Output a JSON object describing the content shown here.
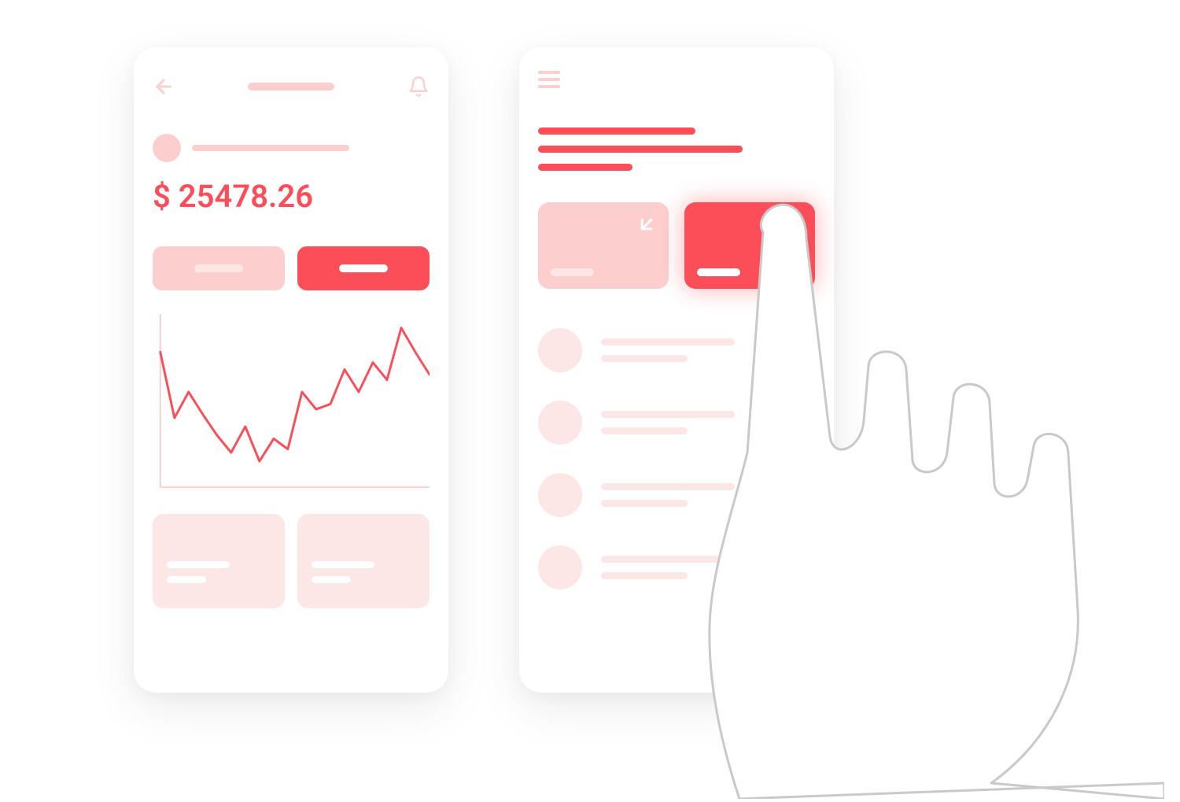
{
  "colors": {
    "accent": "#fb4e58",
    "accent_light": "#fccfce",
    "accent_extra_light": "#fde7e6",
    "white": "#ffffff",
    "hand_stroke": "#c9c9c9"
  },
  "left_screen": {
    "icons": {
      "back": "arrow-left",
      "notification": "bell"
    },
    "balance": {
      "currency": "$",
      "amount": "25478.26",
      "display": "$ 25478.26"
    },
    "buttons": {
      "count": 2,
      "selected_index": 1
    },
    "info_cards": {
      "count": 2
    }
  },
  "right_screen": {
    "icons": {
      "menu": "hamburger"
    },
    "action_cards": [
      {
        "icon": "arrow-down-left",
        "selected": false
      },
      {
        "icon": "arrow-up-right",
        "selected": true
      }
    ],
    "list_items_count": 4
  },
  "chart_data": {
    "type": "line",
    "title": "",
    "xlabel": "",
    "ylabel": "",
    "x": [
      0,
      1,
      2,
      3,
      4,
      5,
      6,
      7,
      8,
      9,
      10,
      11,
      12,
      13,
      14,
      15,
      16,
      17,
      18,
      19
    ],
    "values": [
      78,
      40,
      55,
      42,
      30,
      20,
      35,
      15,
      28,
      22,
      55,
      45,
      48,
      68,
      55,
      72,
      62,
      92,
      78,
      65
    ],
    "ylim": [
      0,
      100
    ],
    "grid": false
  }
}
